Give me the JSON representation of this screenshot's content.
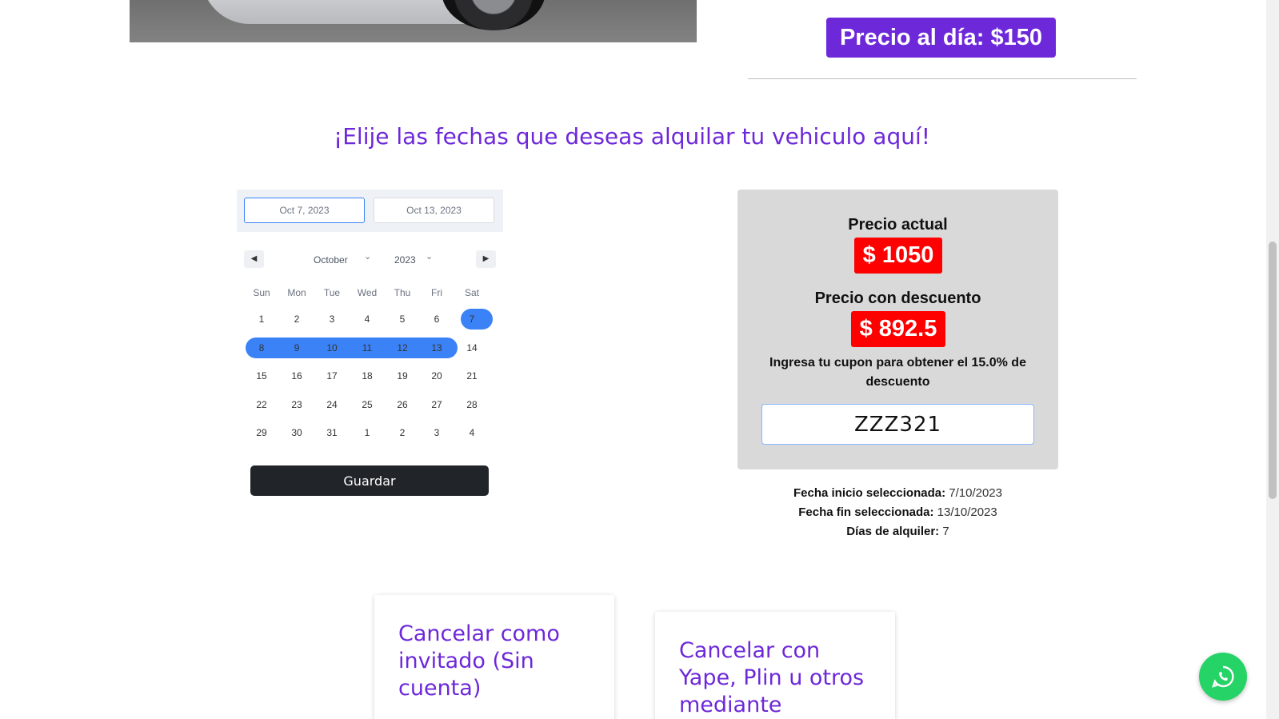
{
  "top": {
    "price_per_day": "Precio al día: $150"
  },
  "headline": "¡Elije las fechas que deseas alquilar tu vehiculo aquí!",
  "calendar": {
    "start_input": "Oct 7, 2023",
    "end_input": "Oct 13, 2023",
    "prev_label": "◀",
    "next_label": "▶",
    "month": "October",
    "year": "2023",
    "weekdays": [
      "Sun",
      "Mon",
      "Tue",
      "Wed",
      "Thu",
      "Fri",
      "Sat"
    ],
    "weeks": [
      [
        "1",
        "2",
        "3",
        "4",
        "5",
        "6",
        "7"
      ],
      [
        "8",
        "9",
        "10",
        "11",
        "12",
        "13",
        "14"
      ],
      [
        "15",
        "16",
        "17",
        "18",
        "19",
        "20",
        "21"
      ],
      [
        "22",
        "23",
        "24",
        "25",
        "26",
        "27",
        "28"
      ],
      [
        "29",
        "30",
        "31",
        "1",
        "2",
        "3",
        "4"
      ]
    ],
    "save_label": "Guardar"
  },
  "prices": {
    "current_label": "Precio actual",
    "current_value": "$ 1050",
    "discount_label": "Precio con descuento",
    "discount_value": "$ 892.5",
    "coupon_text": "Ingresa tu cupon para obtener el 15.0% de descuento",
    "coupon_value": "ZZZ321"
  },
  "summary": {
    "start_label": "Fecha inicio seleccionada:",
    "start_value": "7/10/2023",
    "end_label": "Fecha fin seleccionada:",
    "end_value": "13/10/2023",
    "days_label": "Días de alquiler:",
    "days_value": "7"
  },
  "cards": {
    "guest": "Cancelar como invitado (Sin cuenta)",
    "yape": "Cancelar con Yape, Plin u otros mediante"
  },
  "colors": {
    "accent": "#6d28d9",
    "range": "#3b82f6",
    "badge": "#ff0000",
    "whatsapp": "#25d366"
  }
}
